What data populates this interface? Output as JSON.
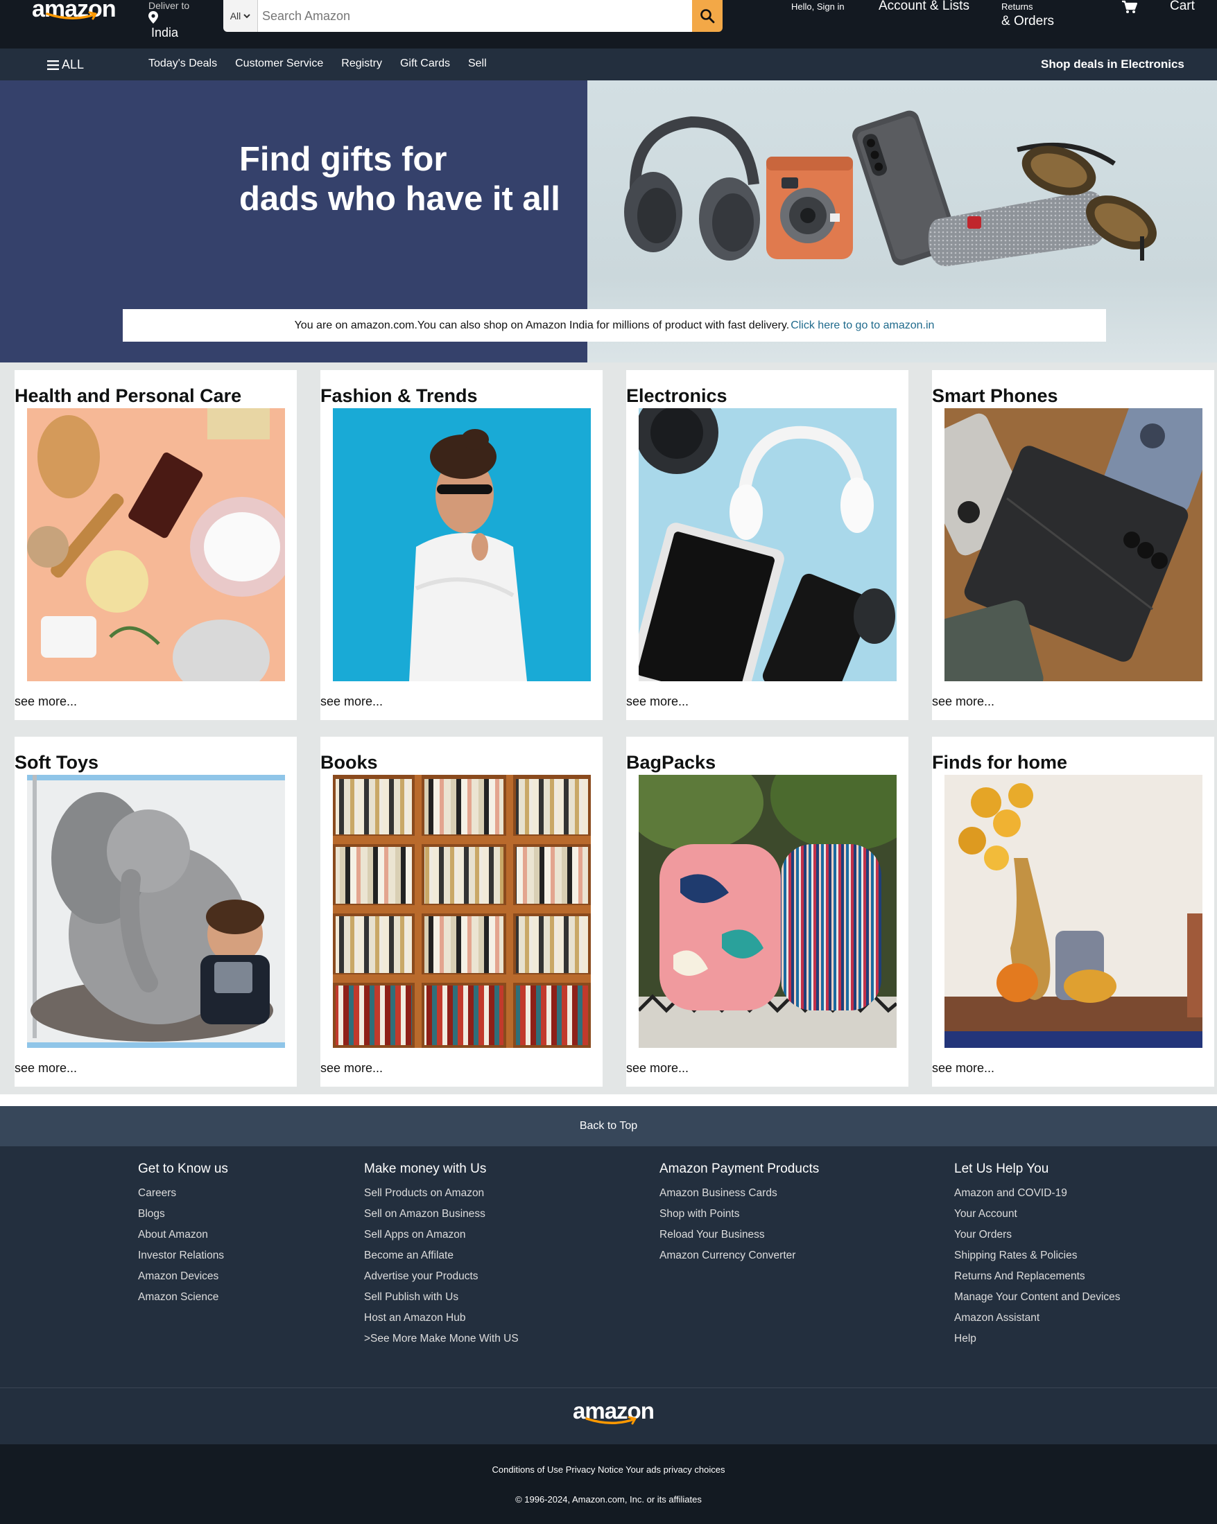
{
  "header": {
    "logo_text": "amazon",
    "deliver_label": "Deliver to",
    "deliver_location": "India",
    "search_category": "All",
    "search_placeholder": "Search Amazon",
    "signin_label": "Hello, Sign in",
    "account_label": "Account & Lists",
    "returns_label": "Returns",
    "orders_label": "& Orders",
    "cart_label": "Cart"
  },
  "nav": {
    "all_label": "ALL",
    "links": [
      "Today's Deals",
      "Customer Service",
      "Registry",
      "Gift Cards",
      "Sell"
    ],
    "promo": "Shop deals in Electronics"
  },
  "hero": {
    "title": "Find gifts for\ndads who have it all",
    "notice_text": "You are on amazon.com.You can also shop on Amazon India for millions of product with fast delivery.",
    "notice_link": "Click here to go to amazon.in"
  },
  "categories": [
    {
      "title": "Health and Personal Care",
      "more": "see more..."
    },
    {
      "title": "Fashion & Trends",
      "more": "see more..."
    },
    {
      "title": "Electronics",
      "more": "see more..."
    },
    {
      "title": "Smart Phones",
      "more": "see more..."
    },
    {
      "title": "Soft Toys",
      "more": "see more..."
    },
    {
      "title": "Books",
      "more": "see more..."
    },
    {
      "title": "BagPacks",
      "more": "see more..."
    },
    {
      "title": "Finds for home",
      "more": "see more..."
    }
  ],
  "footer": {
    "back_to_top": "Back to Top",
    "columns": [
      {
        "heading": "Get to Know us",
        "links": [
          "Careers",
          "Blogs",
          "About Amazon",
          "Investor Relations",
          "Amazon Devices",
          "Amazon Science"
        ]
      },
      {
        "heading": "Make money with Us",
        "links": [
          "Sell Products on Amazon",
          "Sell on Amazon Business",
          "Sell Apps on Amazon",
          "Become an Affilate",
          "Advertise your Products",
          "Sell Publish with Us",
          "Host an Amazon Hub",
          ">See More Make Mone With US"
        ]
      },
      {
        "heading": "Amazon Payment Products",
        "links": [
          "Amazon Business Cards",
          "Shop with Points",
          "Reload Your Business",
          "Amazon Currency Converter"
        ]
      },
      {
        "heading": "Let Us Help You",
        "links": [
          "Amazon and COVID-19",
          "Your Account",
          "Your Orders",
          "Shipping Rates & Policies",
          "Returns And Replacements",
          "Manage Your Content and Devices",
          "Amazon Assistant",
          "Help"
        ]
      }
    ],
    "logo_text": "amazon",
    "legal": "Conditions of Use Privacy Notice Your ads privacy choices",
    "copyright": "© 1996-2024, Amazon.com, Inc. or its affiliates"
  },
  "colors": {
    "header_bg": "#131921",
    "nav_bg": "#232f3e",
    "search_button": "#f3a847",
    "hero_left": "#35416b",
    "link": "#1f6a8c"
  },
  "icons": [
    "location-pin-icon",
    "chevron-down-icon",
    "search-icon",
    "cart-icon",
    "hamburger-icon",
    "amazon-smile-icon"
  ]
}
